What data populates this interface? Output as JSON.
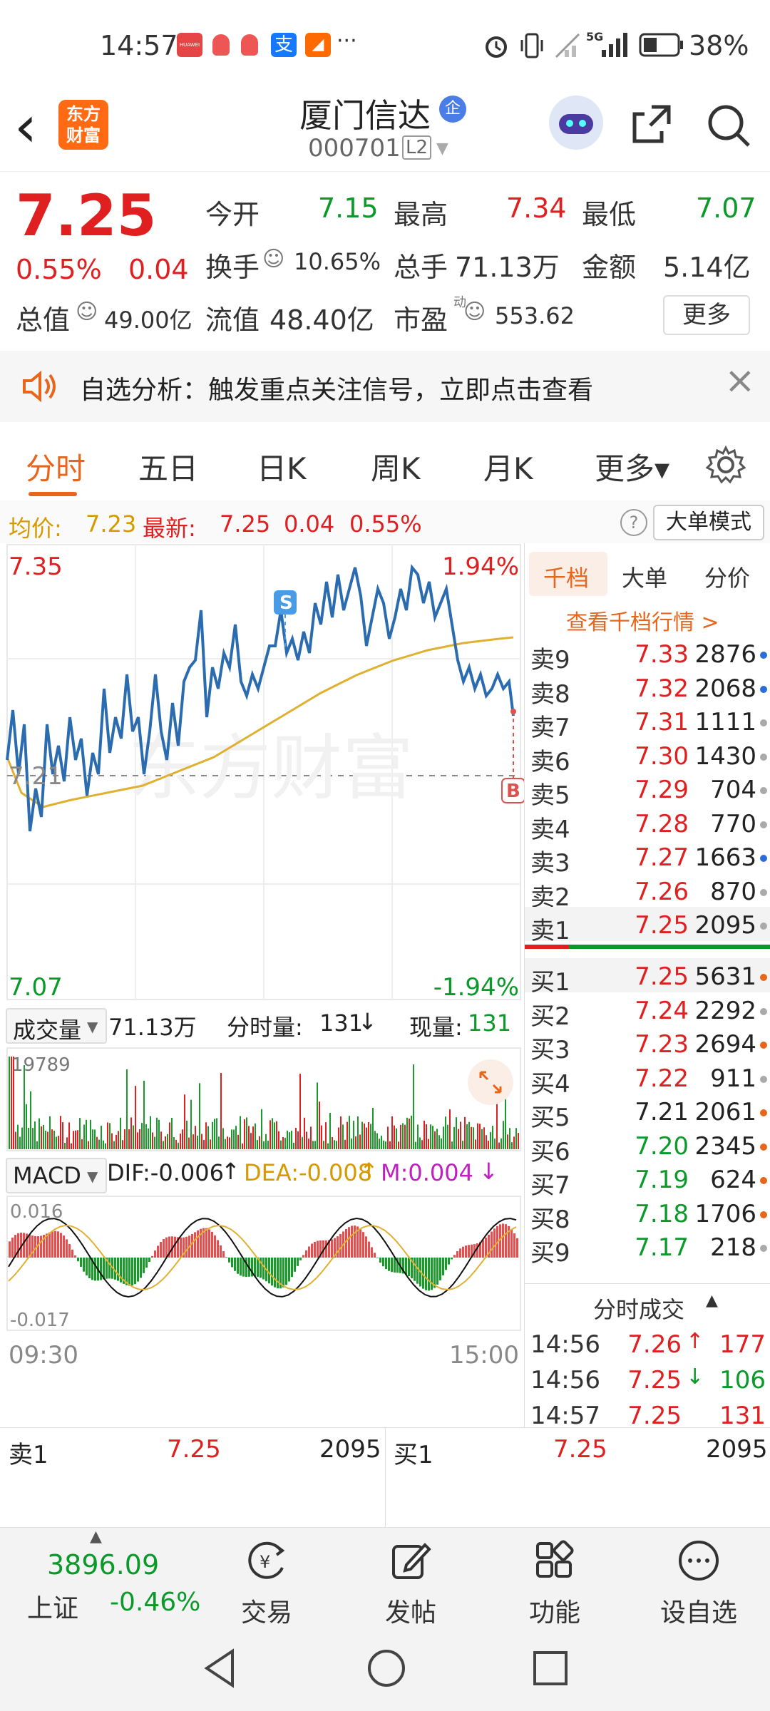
{
  "status_bar": {
    "time": "14:57",
    "signal": "5G",
    "battery": "38%",
    "more": "···",
    "app_tags": [
      "HUAWEI",
      "支",
      "◢"
    ]
  },
  "header": {
    "back": "‹",
    "logo_text": "东方\n财富",
    "stock_name": "厦门信达",
    "badge": "企",
    "stock_code": "000701",
    "level": "L2"
  },
  "quote": {
    "price": "7.25",
    "change_pct": "0.55%",
    "change": "0.04",
    "open_label": "今开",
    "open": "7.15",
    "high_label": "最高",
    "high": "7.34",
    "low_label": "最低",
    "low": "7.07",
    "turnover_label": "换手",
    "turnover": "10.65%",
    "volume_label": "总手",
    "volume": "71.13万",
    "amount_label": "金额",
    "amount": "5.14亿",
    "mktcap_label": "总值",
    "mktcap": "49.00亿",
    "float_label": "流值",
    "float": "48.40亿",
    "pe_label": "市盈",
    "pe_sup": "动",
    "pe": "553.62",
    "more_button": "更多"
  },
  "banner": {
    "text": "自选分析：触发重点关注信号，立即点击查看",
    "close": "×"
  },
  "tabs": [
    {
      "label": "分时",
      "active": true
    },
    {
      "label": "五日",
      "active": false
    },
    {
      "label": "日K",
      "active": false
    },
    {
      "label": "周K",
      "active": false
    },
    {
      "label": "月K",
      "active": false
    },
    {
      "label": "更多▾",
      "active": false
    }
  ],
  "info_line": {
    "avg_label": "均价:",
    "avg": "7.23",
    "latest_label": "最新:",
    "latest": "7.25",
    "change": "0.04",
    "change_pct": "0.55%",
    "help": "?",
    "mode_button": "大单模式"
  },
  "price_chart": {
    "y_top": "7.35",
    "y_mid": "7.21",
    "y_bottom": "7.07",
    "pct_top": "1.94%",
    "pct_bottom": "-1.94%",
    "s_marker": "S",
    "b_marker": "B",
    "watermark": "东方财富",
    "colors": {
      "price_line": "#2b6cb0",
      "avg_line": "#e0b030"
    }
  },
  "volume_bar": {
    "label": "成交量",
    "total": "71.13万",
    "minute_label": "分时量:",
    "minute": "131",
    "current_label": "现量:",
    "current": "131",
    "max": "19789"
  },
  "macd": {
    "label": "MACD",
    "dif": "DIF:-0.006",
    "dea": "DEA:-0.008",
    "m": "M:0.004",
    "y_top": "0.016",
    "y_bottom": "-0.017",
    "time_start": "09:30",
    "time_end": "15:00"
  },
  "orderbook": {
    "tabs": [
      "千档",
      "大单",
      "分价"
    ],
    "link": "查看千档行情 >",
    "sells": [
      {
        "label": "卖9",
        "price": "7.33",
        "vol": "2876",
        "dot": "blue"
      },
      {
        "label": "卖8",
        "price": "7.32",
        "vol": "2068",
        "dot": "blue"
      },
      {
        "label": "卖7",
        "price": "7.31",
        "vol": "1111",
        "dot": "gray"
      },
      {
        "label": "卖6",
        "price": "7.30",
        "vol": "1430",
        "dot": "gray"
      },
      {
        "label": "卖5",
        "price": "7.29",
        "vol": "704",
        "dot": "gray"
      },
      {
        "label": "卖4",
        "price": "7.28",
        "vol": "770",
        "dot": "gray"
      },
      {
        "label": "卖3",
        "price": "7.27",
        "vol": "1663",
        "dot": "blue"
      },
      {
        "label": "卖2",
        "price": "7.26",
        "vol": "870",
        "dot": "gray"
      },
      {
        "label": "卖1",
        "price": "7.25",
        "vol": "2095",
        "dot": "gray"
      }
    ],
    "buys": [
      {
        "label": "买1",
        "price": "7.25",
        "vol": "5631",
        "dot": "orange"
      },
      {
        "label": "买2",
        "price": "7.24",
        "vol": "2292",
        "dot": "gray"
      },
      {
        "label": "买3",
        "price": "7.23",
        "vol": "2694",
        "dot": "orange"
      },
      {
        "label": "买4",
        "price": "7.22",
        "vol": "911",
        "dot": "gray"
      },
      {
        "label": "买5",
        "price": "7.21",
        "vol": "2061",
        "dot": "orange"
      },
      {
        "label": "买6",
        "price": "7.20",
        "vol": "2345",
        "dot": "orange"
      },
      {
        "label": "买7",
        "price": "7.19",
        "vol": "624",
        "dot": "orange"
      },
      {
        "label": "买8",
        "price": "7.18",
        "vol": "1706",
        "dot": "orange"
      },
      {
        "label": "买9",
        "price": "7.17",
        "vol": "218",
        "dot": "gray"
      }
    ],
    "trades_title": "分时成交",
    "trades": [
      {
        "time": "14:56",
        "price": "7.26",
        "arrow": "↑",
        "vol": "177",
        "dir": "up"
      },
      {
        "time": "14:56",
        "price": "7.25",
        "arrow": "↓",
        "vol": "106",
        "dir": "down"
      },
      {
        "time": "14:57",
        "price": "7.25",
        "arrow": "",
        "vol": "131",
        "dir": "flat"
      }
    ]
  },
  "bottom_quote": {
    "sell_label": "卖1",
    "sell_price": "7.25",
    "sell_vol": "2095",
    "buy_label": "买1",
    "buy_price": "7.25",
    "buy_vol": "2095"
  },
  "bottom_bar": {
    "index_value": "3896.09",
    "index_name": "上证",
    "index_change": "-0.46%",
    "items": [
      "交易",
      "发帖",
      "功能",
      "设自选"
    ]
  }
}
